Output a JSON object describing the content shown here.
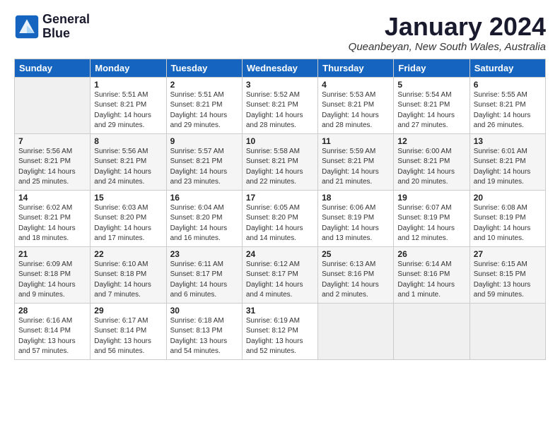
{
  "logo": {
    "line1": "General",
    "line2": "Blue"
  },
  "title": "January 2024",
  "subtitle": "Queanbeyan, New South Wales, Australia",
  "header": {
    "days": [
      "Sunday",
      "Monday",
      "Tuesday",
      "Wednesday",
      "Thursday",
      "Friday",
      "Saturday"
    ]
  },
  "weeks": [
    [
      {
        "num": "",
        "info": ""
      },
      {
        "num": "1",
        "info": "Sunrise: 5:51 AM\nSunset: 8:21 PM\nDaylight: 14 hours\nand 29 minutes."
      },
      {
        "num": "2",
        "info": "Sunrise: 5:51 AM\nSunset: 8:21 PM\nDaylight: 14 hours\nand 29 minutes."
      },
      {
        "num": "3",
        "info": "Sunrise: 5:52 AM\nSunset: 8:21 PM\nDaylight: 14 hours\nand 28 minutes."
      },
      {
        "num": "4",
        "info": "Sunrise: 5:53 AM\nSunset: 8:21 PM\nDaylight: 14 hours\nand 28 minutes."
      },
      {
        "num": "5",
        "info": "Sunrise: 5:54 AM\nSunset: 8:21 PM\nDaylight: 14 hours\nand 27 minutes."
      },
      {
        "num": "6",
        "info": "Sunrise: 5:55 AM\nSunset: 8:21 PM\nDaylight: 14 hours\nand 26 minutes."
      }
    ],
    [
      {
        "num": "7",
        "info": "Sunrise: 5:56 AM\nSunset: 8:21 PM\nDaylight: 14 hours\nand 25 minutes."
      },
      {
        "num": "8",
        "info": "Sunrise: 5:56 AM\nSunset: 8:21 PM\nDaylight: 14 hours\nand 24 minutes."
      },
      {
        "num": "9",
        "info": "Sunrise: 5:57 AM\nSunset: 8:21 PM\nDaylight: 14 hours\nand 23 minutes."
      },
      {
        "num": "10",
        "info": "Sunrise: 5:58 AM\nSunset: 8:21 PM\nDaylight: 14 hours\nand 22 minutes."
      },
      {
        "num": "11",
        "info": "Sunrise: 5:59 AM\nSunset: 8:21 PM\nDaylight: 14 hours\nand 21 minutes."
      },
      {
        "num": "12",
        "info": "Sunrise: 6:00 AM\nSunset: 8:21 PM\nDaylight: 14 hours\nand 20 minutes."
      },
      {
        "num": "13",
        "info": "Sunrise: 6:01 AM\nSunset: 8:21 PM\nDaylight: 14 hours\nand 19 minutes."
      }
    ],
    [
      {
        "num": "14",
        "info": "Sunrise: 6:02 AM\nSunset: 8:21 PM\nDaylight: 14 hours\nand 18 minutes."
      },
      {
        "num": "15",
        "info": "Sunrise: 6:03 AM\nSunset: 8:20 PM\nDaylight: 14 hours\nand 17 minutes."
      },
      {
        "num": "16",
        "info": "Sunrise: 6:04 AM\nSunset: 8:20 PM\nDaylight: 14 hours\nand 16 minutes."
      },
      {
        "num": "17",
        "info": "Sunrise: 6:05 AM\nSunset: 8:20 PM\nDaylight: 14 hours\nand 14 minutes."
      },
      {
        "num": "18",
        "info": "Sunrise: 6:06 AM\nSunset: 8:19 PM\nDaylight: 14 hours\nand 13 minutes."
      },
      {
        "num": "19",
        "info": "Sunrise: 6:07 AM\nSunset: 8:19 PM\nDaylight: 14 hours\nand 12 minutes."
      },
      {
        "num": "20",
        "info": "Sunrise: 6:08 AM\nSunset: 8:19 PM\nDaylight: 14 hours\nand 10 minutes."
      }
    ],
    [
      {
        "num": "21",
        "info": "Sunrise: 6:09 AM\nSunset: 8:18 PM\nDaylight: 14 hours\nand 9 minutes."
      },
      {
        "num": "22",
        "info": "Sunrise: 6:10 AM\nSunset: 8:18 PM\nDaylight: 14 hours\nand 7 minutes."
      },
      {
        "num": "23",
        "info": "Sunrise: 6:11 AM\nSunset: 8:17 PM\nDaylight: 14 hours\nand 6 minutes."
      },
      {
        "num": "24",
        "info": "Sunrise: 6:12 AM\nSunset: 8:17 PM\nDaylight: 14 hours\nand 4 minutes."
      },
      {
        "num": "25",
        "info": "Sunrise: 6:13 AM\nSunset: 8:16 PM\nDaylight: 14 hours\nand 2 minutes."
      },
      {
        "num": "26",
        "info": "Sunrise: 6:14 AM\nSunset: 8:16 PM\nDaylight: 14 hours\nand 1 minute."
      },
      {
        "num": "27",
        "info": "Sunrise: 6:15 AM\nSunset: 8:15 PM\nDaylight: 13 hours\nand 59 minutes."
      }
    ],
    [
      {
        "num": "28",
        "info": "Sunrise: 6:16 AM\nSunset: 8:14 PM\nDaylight: 13 hours\nand 57 minutes."
      },
      {
        "num": "29",
        "info": "Sunrise: 6:17 AM\nSunset: 8:14 PM\nDaylight: 13 hours\nand 56 minutes."
      },
      {
        "num": "30",
        "info": "Sunrise: 6:18 AM\nSunset: 8:13 PM\nDaylight: 13 hours\nand 54 minutes."
      },
      {
        "num": "31",
        "info": "Sunrise: 6:19 AM\nSunset: 8:12 PM\nDaylight: 13 hours\nand 52 minutes."
      },
      {
        "num": "",
        "info": ""
      },
      {
        "num": "",
        "info": ""
      },
      {
        "num": "",
        "info": ""
      }
    ]
  ]
}
